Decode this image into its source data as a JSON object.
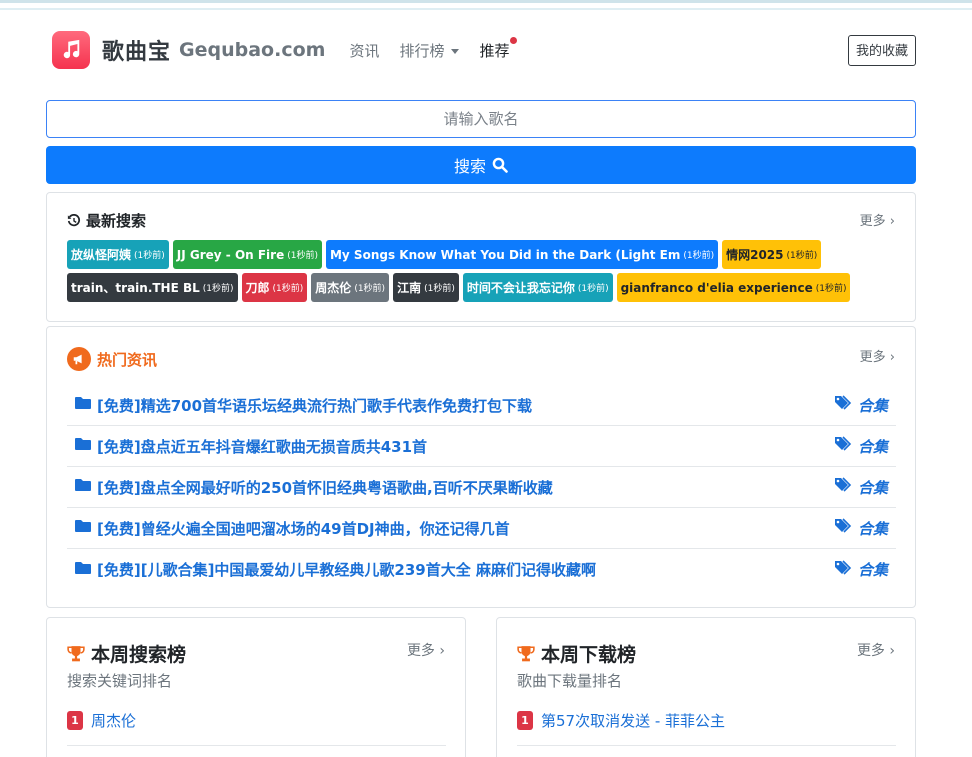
{
  "header": {
    "brand": "歌曲宝",
    "domain": "Gequbao.com",
    "nav": {
      "news": "资讯",
      "charts": "排行榜",
      "recommend": "推荐"
    },
    "favorites_button": "我的收藏"
  },
  "search": {
    "placeholder": "请输入歌名",
    "button_label": "搜索"
  },
  "recent_search": {
    "title": "最新搜索",
    "more": "更多",
    "tags_row1": [
      {
        "text": "放纵怪阿姨",
        "time": "(1秒前)",
        "style": "info"
      },
      {
        "text": "JJ Grey - On Fire",
        "time": "(1秒前)",
        "style": "success"
      },
      {
        "text": "My Songs Know What You Did in the Dark (Light Em",
        "time": "(1秒前)",
        "style": "primary"
      },
      {
        "text": "情网2025",
        "time": "(1秒前)",
        "style": "warning"
      }
    ],
    "tags_row2": [
      {
        "text": "train、train.THE BL",
        "time": "(1秒前)",
        "style": "dark"
      },
      {
        "text": "刀郎",
        "time": "(1秒前)",
        "style": "danger"
      },
      {
        "text": "周杰伦",
        "time": "(1秒前)",
        "style": "secondary"
      },
      {
        "text": "江南",
        "time": "(1秒前)",
        "style": "dark"
      },
      {
        "text": "时间不会让我忘记你",
        "time": "(1秒前)",
        "style": "info"
      },
      {
        "text": "gianfranco d'elia experience",
        "time": "(1秒前)",
        "style": "warning"
      }
    ]
  },
  "hot_news": {
    "title": "热门资讯",
    "more": "更多",
    "items": [
      {
        "title": "[免费]精选700首华语乐坛经典流行热门歌手代表作免费打包下载",
        "tag": "合集"
      },
      {
        "title": "[免费]盘点近五年抖音爆红歌曲无损音质共431首",
        "tag": "合集"
      },
      {
        "title": "[免费]盘点全网最好听的250首怀旧经典粤语歌曲,百听不厌果断收藏",
        "tag": "合集"
      },
      {
        "title": "[免费]曾经火遍全国迪吧溜冰场的49首DJ神曲，你还记得几首",
        "tag": "合集"
      },
      {
        "title": "[免费][儿歌合集]中国最爱幼儿早教经典儿歌239首大全 麻麻们记得收藏啊",
        "tag": "合集"
      }
    ]
  },
  "weekly_search": {
    "title": "本周搜索榜",
    "subtitle": "搜索关键词排名",
    "more": "更多",
    "first": {
      "rank": "1",
      "name": "周杰伦"
    }
  },
  "weekly_download": {
    "title": "本周下载榜",
    "subtitle": "歌曲下载量排名",
    "more": "更多",
    "first": {
      "rank": "1",
      "name": "第57次取消发送 - 菲菲公主"
    }
  },
  "colors": {
    "primary": "#0d7bfd",
    "link": "#1a6fd6",
    "hot": "#f06a1d",
    "trophy": "#f06a1d",
    "danger": "#dc3545"
  }
}
